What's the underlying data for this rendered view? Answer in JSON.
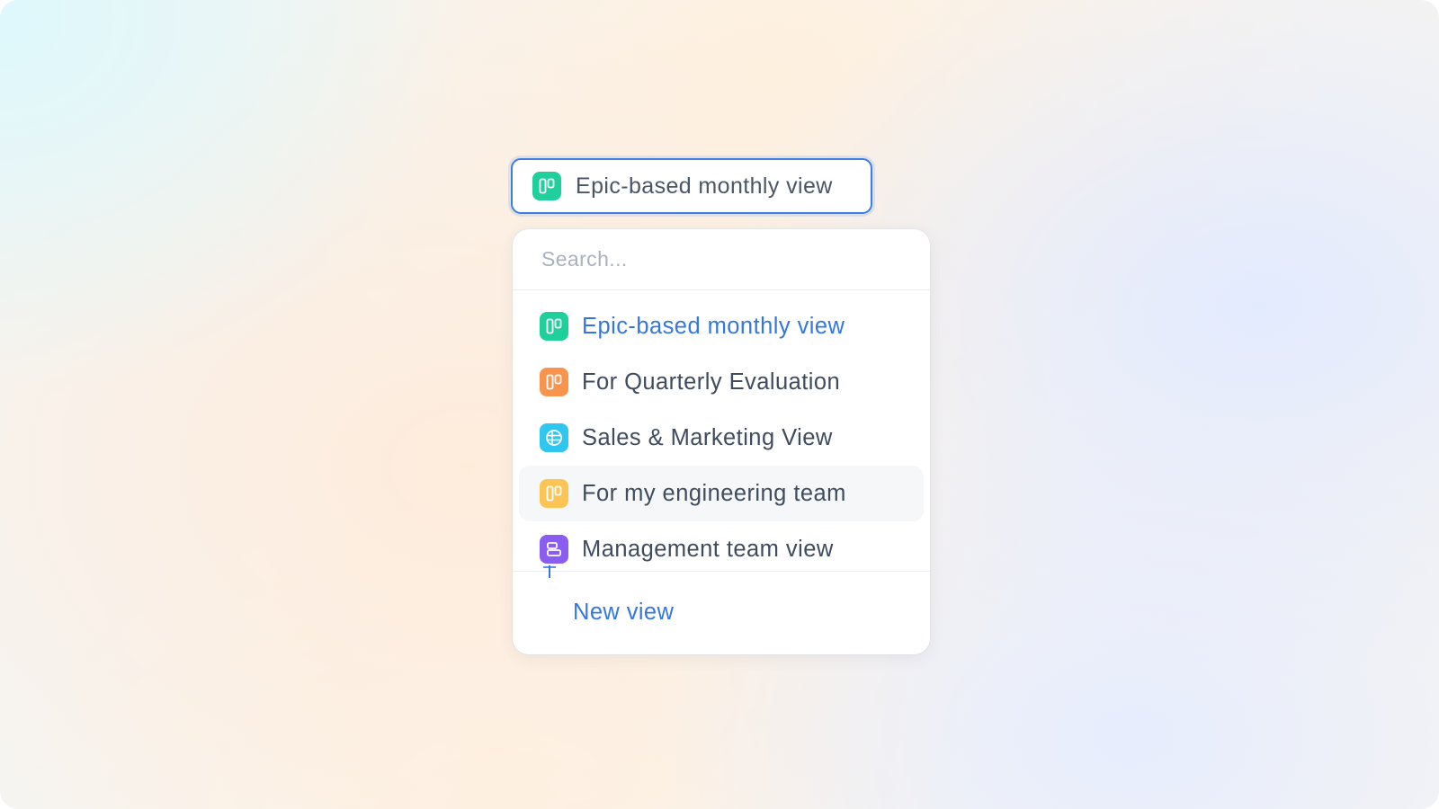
{
  "selector": {
    "current_view": "Epic-based monthly view",
    "current_icon": "board-icon",
    "current_color": "#1fcf9c"
  },
  "search": {
    "placeholder": "Search..."
  },
  "views": [
    {
      "label": "Epic-based monthly view",
      "icon": "board-icon",
      "color": "#1fcf9c",
      "selected": true
    },
    {
      "label": "For Quarterly Evaluation",
      "icon": "board-icon",
      "color": "#f8944e",
      "selected": false
    },
    {
      "label": "Sales & Marketing View",
      "icon": "table-grid-icon",
      "color": "#2fc6f0",
      "selected": false
    },
    {
      "label": "For my engineering team",
      "icon": "board-icon",
      "color": "#fcc455",
      "selected": false,
      "hovered": true
    },
    {
      "label": "Management team view",
      "icon": "timeline-icon",
      "color": "#8a5cf2",
      "selected": false
    }
  ],
  "footer": {
    "new_view_label": "New view"
  },
  "colors": {
    "accent": "#3577e0",
    "text": "#3f4b5e"
  }
}
